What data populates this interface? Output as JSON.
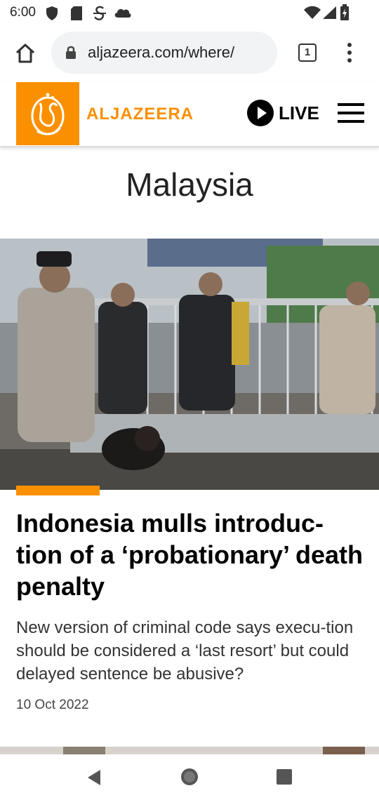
{
  "status_bar": {
    "time": "6:00"
  },
  "browser": {
    "url": "aljazeera.com/where/",
    "tab_count": "1"
  },
  "site": {
    "brand": "ALJAZEERA",
    "live_label": "LIVE"
  },
  "page": {
    "section_title": "Malaysia"
  },
  "article": {
    "headline": "Indonesia mulls introduc-tion of a ‘probationary’ death penalty",
    "summary": "New version of criminal code says execu-tion should be considered a ‘last resort’ but could delayed sentence be abusive?",
    "date": "10 Oct 2022"
  },
  "colors": {
    "accent": "#fa9000"
  },
  "icons": [
    "shield-icon",
    "sd-card-icon",
    "vpn-icon",
    "cloud-icon",
    "wifi-icon",
    "signal-icon",
    "battery-icon",
    "home-icon",
    "lock-icon",
    "tabs-icon",
    "more-vert-icon",
    "play-icon",
    "hamburger-menu-icon",
    "back-icon",
    "home-nav-icon",
    "recents-icon"
  ]
}
